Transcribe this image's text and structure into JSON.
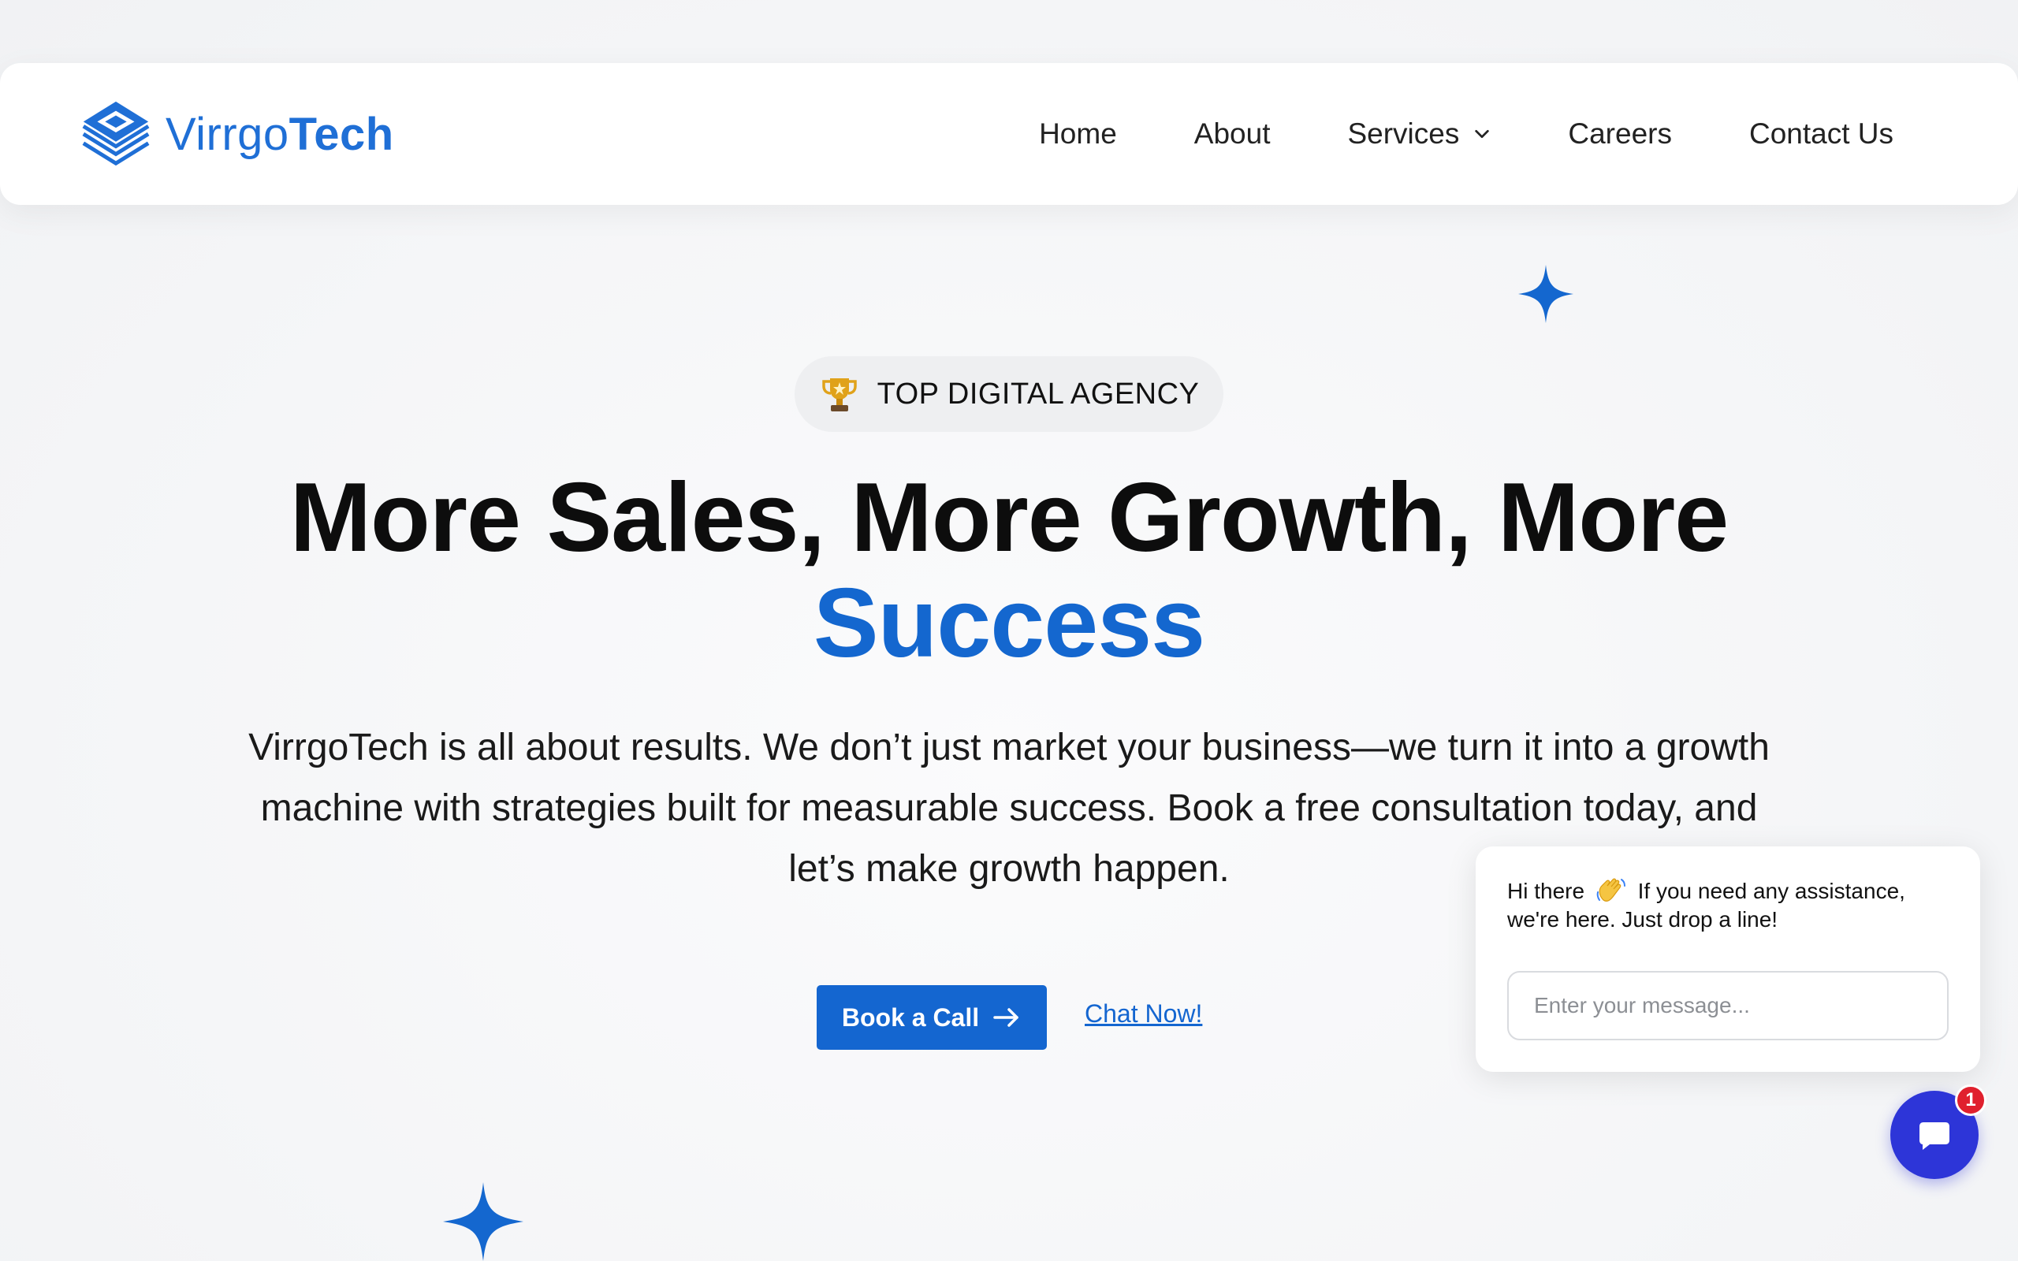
{
  "brand": {
    "name_light": "Virrgo",
    "name_bold": "Tech",
    "color": "#1f6fd6"
  },
  "nav": {
    "items": [
      {
        "label": "Home"
      },
      {
        "label": "About"
      },
      {
        "label": "Services",
        "has_dropdown": true
      },
      {
        "label": "Careers"
      },
      {
        "label": "Contact Us"
      }
    ]
  },
  "hero": {
    "badge": {
      "icon": "trophy-icon",
      "label": "TOP DIGITAL AGENCY"
    },
    "headline_line1": "More Sales, More Growth, More",
    "headline_accent": "Success",
    "lead": "VirrgoTech is all about results. We don’t just market your business—we turn it into a growth machine with strategies built for measurable success. Book a free consultation today, and let’s make growth happen.",
    "primary_cta": "Book a Call",
    "secondary_cta": "Chat Now!"
  },
  "chat": {
    "greeting_before": "Hi there",
    "greeting_after": "If you need any assistance, we're here. Just drop a line!",
    "input_placeholder": "Enter your message...",
    "notification_count": "1"
  },
  "colors": {
    "accent": "#1467cf",
    "chat_button": "#2d35d8",
    "notification": "#e0202e"
  }
}
